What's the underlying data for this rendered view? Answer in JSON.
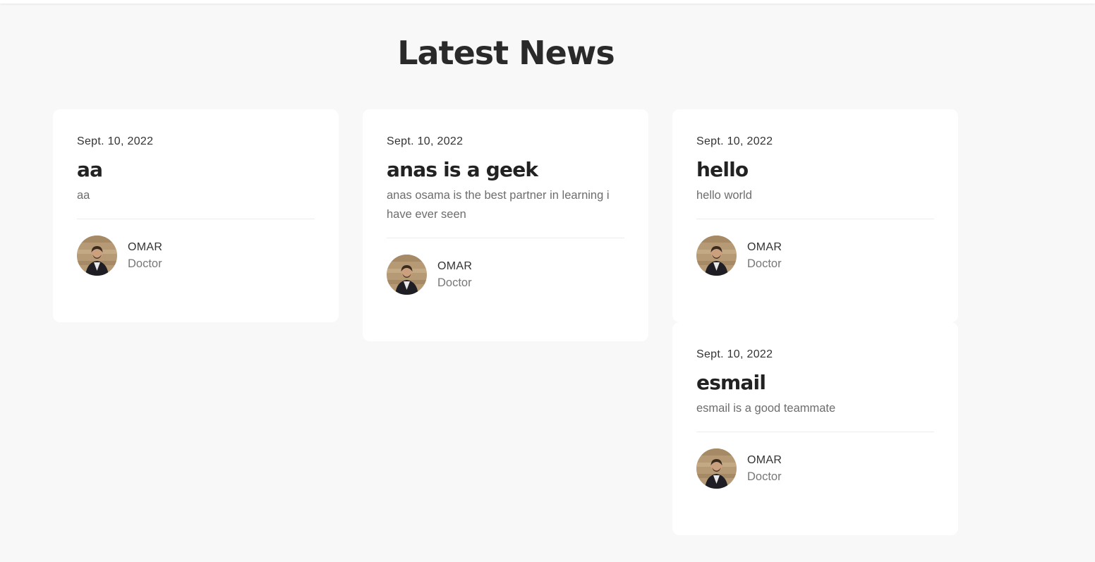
{
  "section": {
    "title": "Latest News"
  },
  "posts": [
    {
      "date": "Sept. 10, 2022",
      "title": "aa",
      "body": "aa",
      "author": {
        "name": "OMAR",
        "role": "Doctor"
      }
    },
    {
      "date": "Sept. 10, 2022",
      "title": "anas is a geek",
      "body": "anas osama is the best partner in learning i have ever seen",
      "author": {
        "name": "OMAR",
        "role": "Doctor"
      }
    },
    {
      "date": "Sept. 10, 2022",
      "title": "hello",
      "body": "hello world",
      "author": {
        "name": "OMAR",
        "role": "Doctor"
      }
    },
    {
      "date": "Sept. 10, 2022",
      "title": "esmail",
      "body": "esmail is a good teammate",
      "author": {
        "name": "OMAR",
        "role": "Doctor"
      }
    }
  ],
  "colors": {
    "page_background": "#f8f8f8",
    "card_background": "#ffffff",
    "heading": "#222222",
    "body_text": "#6d6d6d"
  }
}
